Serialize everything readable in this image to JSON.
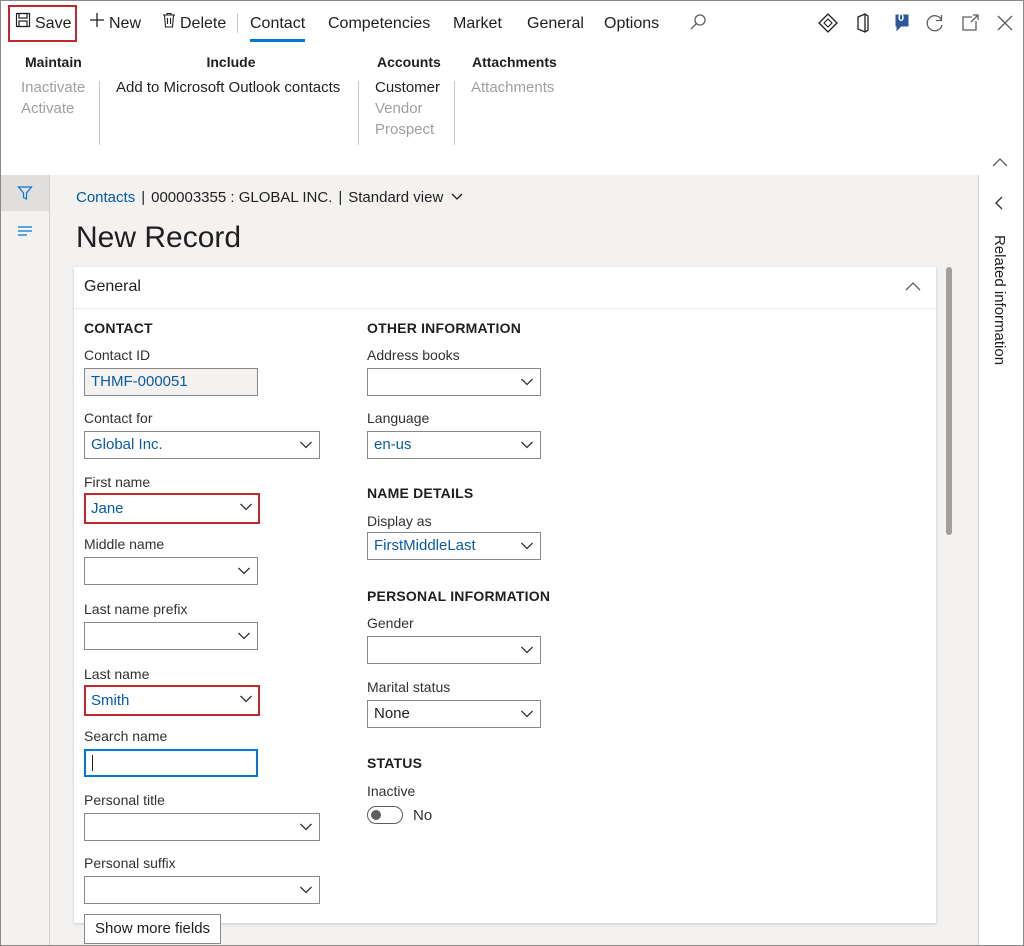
{
  "commandbar": {
    "save": "Save",
    "new": "New",
    "delete": "Delete",
    "tabs": [
      "Contact",
      "Competencies",
      "Market",
      "General",
      "Options"
    ],
    "active_tab": "Contact",
    "notification_count": "0"
  },
  "ribbon": {
    "maintain": {
      "title": "Maintain",
      "items": [
        "Inactivate",
        "Activate"
      ]
    },
    "include": {
      "title": "Include",
      "items": [
        "Add to Microsoft Outlook contacts"
      ]
    },
    "accounts": {
      "title": "Accounts",
      "items": [
        "Customer",
        "Vendor",
        "Prospect"
      ]
    },
    "attachments": {
      "title": "Attachments",
      "items": [
        "Attachments"
      ]
    }
  },
  "breadcrumb": {
    "link": "Contacts",
    "record": "000003355 : GLOBAL INC.",
    "view": "Standard view"
  },
  "page_title": "New Record",
  "general": {
    "header": "General",
    "contact": {
      "title": "CONTACT",
      "contact_id": {
        "label": "Contact ID",
        "value": "THMF-000051"
      },
      "contact_for": {
        "label": "Contact for",
        "value": "Global Inc."
      },
      "first_name": {
        "label": "First name",
        "value": "Jane"
      },
      "middle_name": {
        "label": "Middle name",
        "value": ""
      },
      "last_name_prefix": {
        "label": "Last name prefix",
        "value": ""
      },
      "last_name": {
        "label": "Last name",
        "value": "Smith"
      },
      "search_name": {
        "label": "Search name",
        "value": ""
      },
      "personal_title": {
        "label": "Personal title",
        "value": ""
      },
      "personal_suffix": {
        "label": "Personal suffix",
        "value": ""
      },
      "show_more": "Show more fields"
    },
    "other": {
      "title": "OTHER INFORMATION",
      "address_books": {
        "label": "Address books",
        "value": ""
      },
      "language": {
        "label": "Language",
        "value": "en-us"
      }
    },
    "name_details": {
      "title": "NAME DETAILS",
      "display_as": {
        "label": "Display as",
        "value": "FirstMiddleLast"
      }
    },
    "personal": {
      "title": "PERSONAL INFORMATION",
      "gender": {
        "label": "Gender",
        "value": ""
      },
      "marital_status": {
        "label": "Marital status",
        "value": "None"
      }
    },
    "status": {
      "title": "STATUS",
      "inactive": {
        "label": "Inactive",
        "value": "No"
      }
    }
  },
  "right_pane": {
    "label": "Related information"
  },
  "colors": {
    "accent": "#0078d4",
    "highlight": "#c4262e",
    "link": "#005a9e"
  }
}
